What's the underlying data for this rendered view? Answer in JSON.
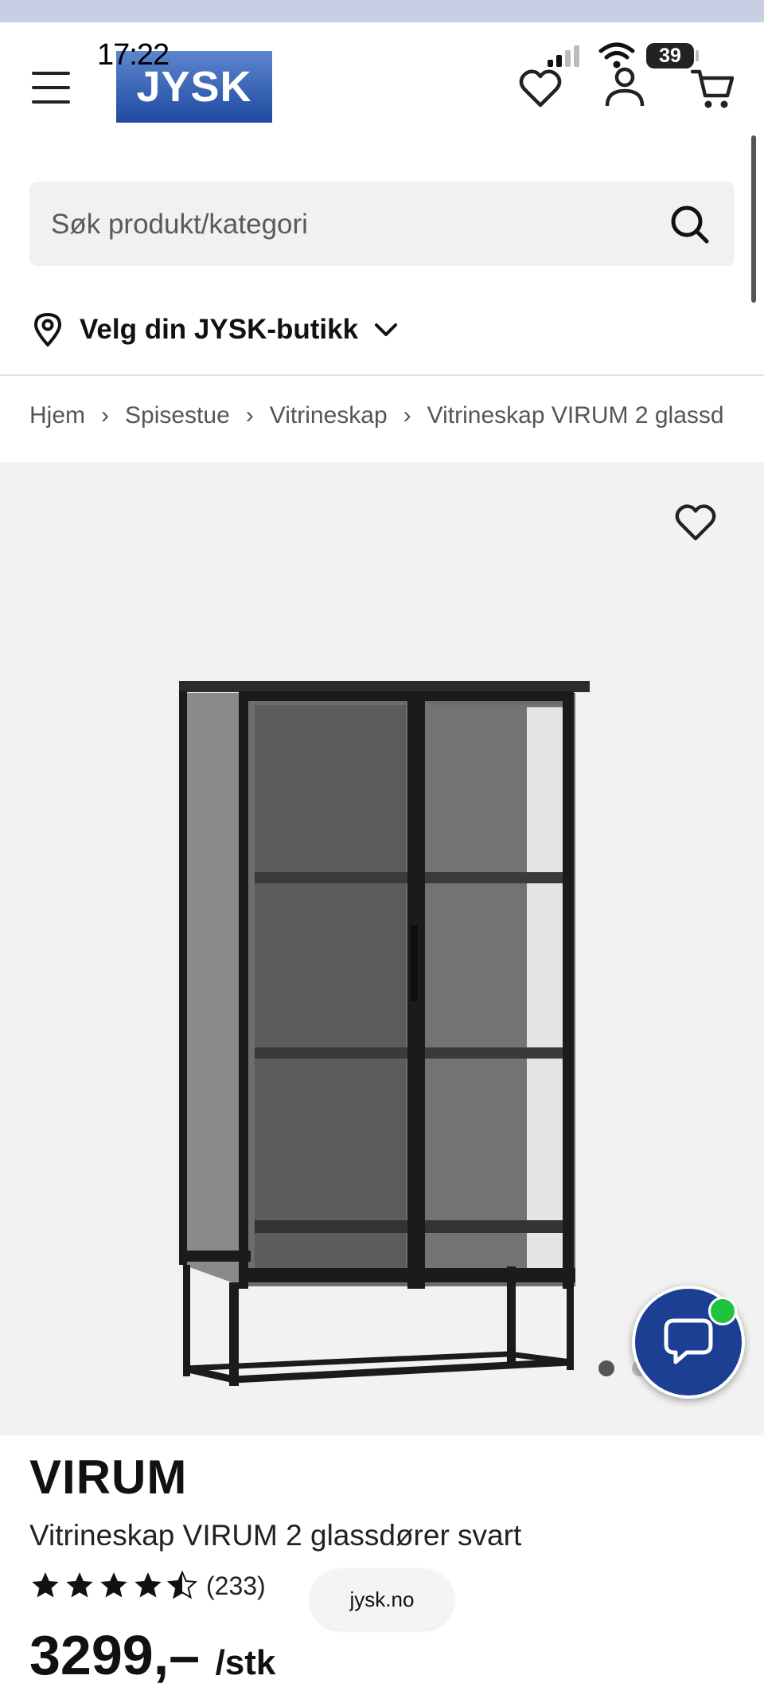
{
  "status_bar": {
    "time": "17:22",
    "battery": "39"
  },
  "header": {
    "logo_text": "JYSK",
    "menu_icon": "hamburger-menu-icon",
    "wishlist_icon": "heart-icon",
    "account_icon": "user-icon",
    "cart_icon": "shopping-cart-icon"
  },
  "search": {
    "placeholder": "Søk produkt/kategori",
    "icon": "search-icon"
  },
  "store_selector": {
    "label": "Velg din JYSK-butikk",
    "icon": "location-pin-icon"
  },
  "breadcrumb": [
    "Hjem",
    "Spisestue",
    "Vitrineskap",
    "Vitrineskap VIRUM 2 glassd"
  ],
  "gallery": {
    "current_image": 1,
    "total_images": 2
  },
  "product": {
    "brand": "VIRUM",
    "name": "Vitrineskap VIRUM 2 glassdører svart",
    "rating": 4.5,
    "rating_max": 5,
    "review_count": "(233)",
    "price": "3299,–",
    "price_unit": "/stk"
  },
  "browser": {
    "url": "jysk.no"
  },
  "colors": {
    "brand_blue": "#1c3f94",
    "online_green": "#20c33c",
    "gallery_bg": "#f2f2f2"
  }
}
